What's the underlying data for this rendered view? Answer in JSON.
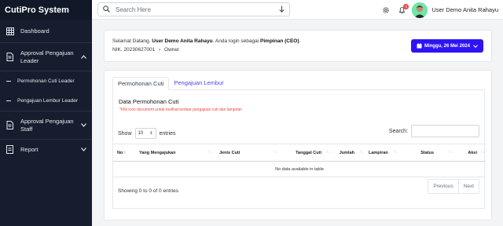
{
  "app": {
    "title": "CutiPro System"
  },
  "sidebar": {
    "items": [
      {
        "label": "Dashboard",
        "icon": "grid-icon"
      },
      {
        "label": "Approval Pengajuan Leader",
        "icon": "document-icon"
      },
      {
        "label": "Permohonan Cuti Leader"
      },
      {
        "label": "Pengajuan Lembur Leader"
      },
      {
        "label": "Approval Pengajuan Staff",
        "icon": "document-icon"
      },
      {
        "label": "Report",
        "icon": "file-icon"
      }
    ]
  },
  "topbar": {
    "search_placeholder": "Search Here",
    "notification_count": "0",
    "user_name": "User Demo Anita Rahayu"
  },
  "welcome": {
    "prefix": "Selamat Datang,",
    "user": "User Demo Anita Rahayu",
    "middle": ". Anda login sebagai",
    "role": "Pimpinan (CEO)",
    "suffix": ".",
    "nik": "NIK. 20230627001",
    "separator": "›",
    "position": "Owner",
    "date": "Minggu, 26 Mei 2024"
  },
  "tabs": [
    {
      "label": "Permohonan Cuti"
    },
    {
      "label": "Pengajuan Lembur"
    }
  ],
  "panel": {
    "title": "Data Permohonan Cuti",
    "note": "*Klik icon document untuk melihat lembar pengajuan cuti dan lampiran",
    "show_label": "Show",
    "show_value": "10",
    "entries_label": "entries",
    "search_label": "Search:"
  },
  "table": {
    "headers": [
      "No",
      "Yang Mengajukan",
      "Jenis Cuti",
      "Tanggal Cuti",
      "Jumlah",
      "Lampiran",
      "Status",
      "Aksi"
    ],
    "empty_text": "No data available in table"
  },
  "footer": {
    "info": "Showing 0 to 0 of 0 entries",
    "prev": "Previous",
    "next": "Next"
  },
  "colors": {
    "sidebar_bg": "#171d2e",
    "accent": "#2e14f5",
    "tab_link": "#4f46e5",
    "note": "#ef4444"
  }
}
